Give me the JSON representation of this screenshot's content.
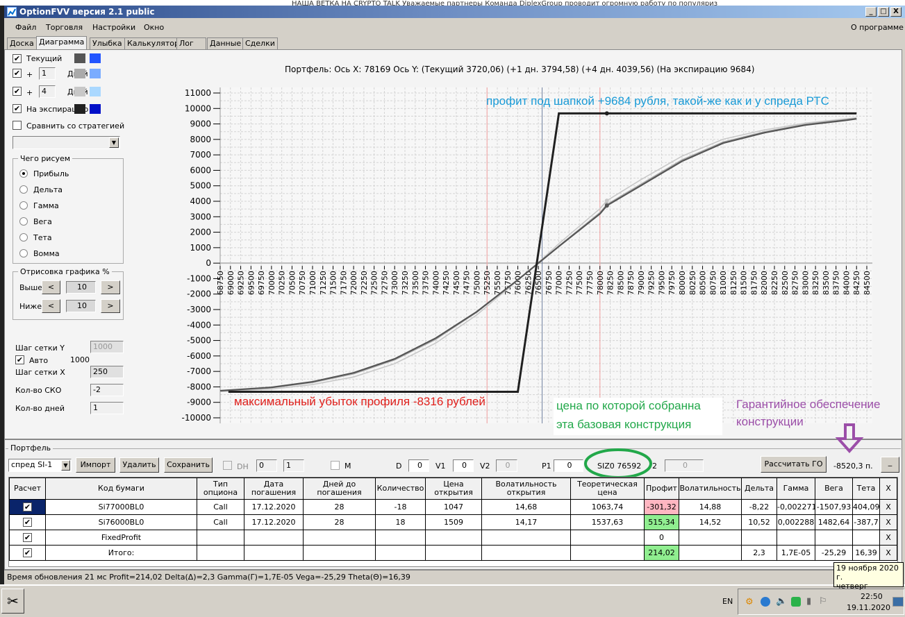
{
  "background_strip": {
    "text": "НАША ВЕТКА НА CRYPTO TALK   Уважаемые партнеры   Команда DiplexGroup проводит огромную работу по популяриз"
  },
  "window": {
    "title": "OptionFVV версия 2.1 public",
    "minimize": "_",
    "maximize": "□",
    "close": "X"
  },
  "menu": {
    "items": [
      "Файл",
      "Торговля",
      "Настройки",
      "Окно"
    ],
    "about": "О программе"
  },
  "tabs": [
    {
      "label": "Доска"
    },
    {
      "label": "Диаграмма",
      "active": true
    },
    {
      "label": "Улыбка"
    },
    {
      "label": "Калькулятор"
    },
    {
      "label": "Лог"
    },
    {
      "label": "Данные"
    },
    {
      "label": "Сделки"
    }
  ],
  "left_panel": {
    "series_rows": [
      {
        "label": "Текущий",
        "checked": true,
        "color1": "#555555",
        "color2": "#2255ff"
      },
      {
        "plus": "+",
        "days": "1",
        "days_label": "Дней",
        "checked": true,
        "color1": "#aaaaaa",
        "color2": "#7aacff"
      },
      {
        "plus": "+",
        "days": "4",
        "days_label": "Дней",
        "checked": true,
        "color1": "#c8c8c8",
        "color2": "#aad8ff"
      },
      {
        "label": "На экспирацию",
        "checked": true,
        "color1": "#202020",
        "color2": "#0010c8"
      }
    ],
    "compare_label": "Сравнить со стратегией",
    "compare_checked": false,
    "strategy_select": "",
    "what_group": {
      "title": "Чего рисуем",
      "options": [
        "Прибыль",
        "Дельта",
        "Гамма",
        "Вега",
        "Тета",
        "Вомма"
      ],
      "selected": "Прибыль"
    },
    "draw_group": {
      "title": "Отрисовка графика %",
      "above_label": "Выше",
      "above_value": "10",
      "below_label": "Ниже",
      "below_value": "10",
      "dec": "<",
      "inc": ">"
    },
    "grid_y_label": "Шаг сетки Y",
    "grid_y_value": "1000",
    "auto_label": "Авто",
    "auto_checked": true,
    "auto_value": "1000",
    "grid_x_label": "Шаг сетки X",
    "grid_x_value": "250",
    "sko_label": "Кол-во СКО",
    "sko_value": "-2",
    "days_label": "Кол-во дней",
    "days_value": "1"
  },
  "chart_header": "Портфель: Ось X: 78169 Ось Y:  (Текущий 3720,06)  (+1 дн. 3794,58)  (+4 дн. 4039,56)  (На экспирацию 9684)",
  "annotations": {
    "top": "профит под шапкой +9684 рубля, такой-же как и у спреда РТС",
    "loss": "максимальный убыток профиля -8316 рублей",
    "price_line1": "цена по которой собранна",
    "price_line2": "эта базовая конструкция",
    "margin_line1": "Гарантийное обеспечение",
    "margin_line2": "конструкции",
    "colors": {
      "top": "#1a9bd7",
      "loss": "#e0201c",
      "price": "#22a84a",
      "margin": "#9b4ea8"
    }
  },
  "chart_data": {
    "type": "line",
    "xlim": [
      68750,
      84500
    ],
    "ylim": [
      -10000,
      11000
    ],
    "x_tick_step": 250,
    "y_tick_step": 1000,
    "grid": true,
    "cursor_x": 78169,
    "vertical_lines": [
      {
        "x": 75250,
        "color": "#f4a0a0"
      },
      {
        "x": 76592,
        "color": "#7080a0"
      },
      {
        "x": 78000,
        "color": "#f4a0a0"
      }
    ],
    "series": [
      {
        "key": "day4",
        "color": "#c8c8c8",
        "points": [
          [
            68750,
            -8300
          ],
          [
            70000,
            -8140
          ],
          [
            71000,
            -7850
          ],
          [
            72000,
            -7360
          ],
          [
            73000,
            -6500
          ],
          [
            74000,
            -5170
          ],
          [
            75000,
            -3350
          ],
          [
            76000,
            -1110
          ],
          [
            76500,
            40
          ],
          [
            77000,
            1260
          ],
          [
            78000,
            3520
          ],
          [
            78169,
            4039.56
          ],
          [
            79000,
            5400
          ],
          [
            80000,
            6920
          ],
          [
            81000,
            8010
          ],
          [
            82000,
            8610
          ],
          [
            83000,
            9050
          ],
          [
            84000,
            9330
          ],
          [
            84250,
            9400
          ]
        ]
      },
      {
        "key": "day1",
        "color": "#aaaaaa",
        "points": [
          [
            68750,
            -8270
          ],
          [
            70000,
            -8060
          ],
          [
            71000,
            -7720
          ],
          [
            72000,
            -7160
          ],
          [
            73000,
            -6260
          ],
          [
            74000,
            -4930
          ],
          [
            75000,
            -3180
          ],
          [
            76000,
            -1090
          ],
          [
            76500,
            10
          ],
          [
            77000,
            1110
          ],
          [
            78000,
            3270
          ],
          [
            78169,
            3794.58
          ],
          [
            79000,
            5110
          ],
          [
            80000,
            6680
          ],
          [
            81000,
            7830
          ],
          [
            82000,
            8490
          ],
          [
            83000,
            8980
          ],
          [
            84000,
            9280
          ],
          [
            84250,
            9360
          ]
        ]
      },
      {
        "key": "current",
        "color": "#555555",
        "points": [
          [
            68750,
            -8250
          ],
          [
            70000,
            -8030
          ],
          [
            71000,
            -7670
          ],
          [
            72000,
            -7090
          ],
          [
            73000,
            -6190
          ],
          [
            74000,
            -4850
          ],
          [
            75000,
            -3140
          ],
          [
            76000,
            -1080
          ],
          [
            76500,
            0
          ],
          [
            77000,
            1080
          ],
          [
            78000,
            3190
          ],
          [
            78169,
            3720.06
          ],
          [
            79000,
            5020
          ],
          [
            80000,
            6590
          ],
          [
            81000,
            7760
          ],
          [
            82000,
            8430
          ],
          [
            83000,
            8930
          ],
          [
            84000,
            9240
          ],
          [
            84250,
            9330
          ]
        ]
      },
      {
        "key": "expiration",
        "color": "#202020",
        "points": [
          [
            68950,
            -8316
          ],
          [
            76000,
            -8316
          ],
          [
            77000,
            9684
          ],
          [
            78169,
            9684
          ],
          [
            84250,
            9684
          ]
        ]
      }
    ]
  },
  "portfolio": {
    "title": "Портфель",
    "select": "спред SI-1",
    "import": "Импорт",
    "delete": "Удалить",
    "save": "Сохранить",
    "dh_label": "DH",
    "spin1": "0",
    "spin2": "1",
    "m_label": "M",
    "d_label": "D",
    "d_value": "0",
    "v1_label": "V1",
    "v1_value": "0",
    "v2_label": "V2",
    "v2_value": "0",
    "p1_label": "P1",
    "p1_value": "0",
    "base_price": "SIZ0 76592",
    "p2_label": "2",
    "p2_value": "0",
    "calc_go": "Рассчитать ГО",
    "go_value": "-8520,3 п.",
    "minimize": "_",
    "columns": [
      "Расчет",
      "Код бумаги",
      "Тип опциона",
      "Дата погашения",
      "Дней до погашения",
      "Количество",
      "Цена открытия",
      "Волатильность открытия",
      "Теоретическая цена",
      "Профит",
      "Волатильность",
      "Дельта",
      "Гамма",
      "Вега",
      "Тета",
      "X"
    ],
    "rows": [
      {
        "cells": [
          "✔",
          "Si77000BL0",
          "Call",
          "17.12.2020",
          "28",
          "-18",
          "1047",
          "14,68",
          "1063,74",
          "-301,32",
          "14,88",
          "-8,22",
          "-0,002271",
          "-1507,93",
          "404,09",
          "X"
        ],
        "profit_color": "#ffb6c1",
        "selected": true
      },
      {
        "cells": [
          "✔",
          "Si76000BL0",
          "Call",
          "17.12.2020",
          "28",
          "18",
          "1509",
          "14,17",
          "1537,63",
          "515,34",
          "14,52",
          "10,52",
          "0,002288",
          "1482,64",
          "-387,7",
          "X"
        ],
        "profit_color": "#90ee90"
      },
      {
        "cells": [
          "✔",
          "FixedProfit",
          "",
          "",
          "",
          "",
          "",
          "",
          "",
          "0",
          "",
          "",
          "",
          "",
          "",
          "X"
        ],
        "profit_color": "#ffffff"
      },
      {
        "cells": [
          "✔",
          "Итого:",
          "",
          "",
          "",
          "",
          "",
          "",
          "",
          "214,02",
          "",
          "2,3",
          "1,7E-05",
          "-25,29",
          "16,39",
          "X"
        ],
        "profit_color": "#90ee90"
      }
    ]
  },
  "status": "Время обновления 21 мс  Profit=214,02 Delta(Δ)=2,3 Gamma(Γ)=1,7E-05 Vega=-25,29 Theta(Θ)=16,39",
  "tooltip": {
    "line1": "19 ноября 2020 г.",
    "line2": "четверг"
  },
  "taskbar": {
    "lang": "EN",
    "time": "22:50",
    "date": "19.11.2020"
  }
}
